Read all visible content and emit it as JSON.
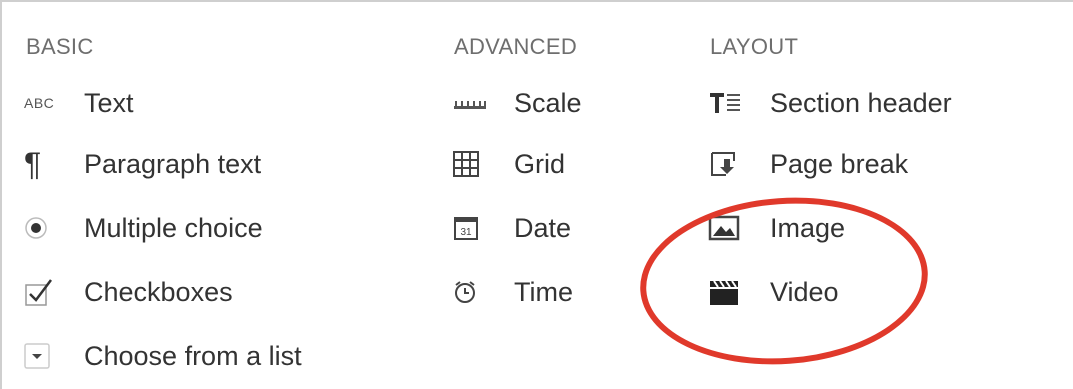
{
  "columns": {
    "basic": {
      "title": "BASIC",
      "items": [
        {
          "label": "Text",
          "icon": "abc-text-icon",
          "icon_text": "ABC"
        },
        {
          "label": "Paragraph text",
          "icon": "paragraph-icon"
        },
        {
          "label": "Multiple choice",
          "icon": "radio-icon"
        },
        {
          "label": "Checkboxes",
          "icon": "checkbox-icon"
        },
        {
          "label": "Choose from a list",
          "icon": "dropdown-icon"
        }
      ]
    },
    "advanced": {
      "title": "ADVANCED",
      "items": [
        {
          "label": "Scale",
          "icon": "scale-icon"
        },
        {
          "label": "Grid",
          "icon": "grid-icon"
        },
        {
          "label": "Date",
          "icon": "calendar-icon",
          "icon_text": "31"
        },
        {
          "label": "Time",
          "icon": "clock-icon"
        }
      ]
    },
    "layout": {
      "title": "LAYOUT",
      "items": [
        {
          "label": "Section header",
          "icon": "section-header-icon"
        },
        {
          "label": "Page break",
          "icon": "page-break-icon"
        },
        {
          "label": "Image",
          "icon": "image-icon"
        },
        {
          "label": "Video",
          "icon": "video-icon"
        }
      ]
    }
  },
  "annotation": {
    "color": "#e0392b",
    "shape": "ellipse"
  }
}
